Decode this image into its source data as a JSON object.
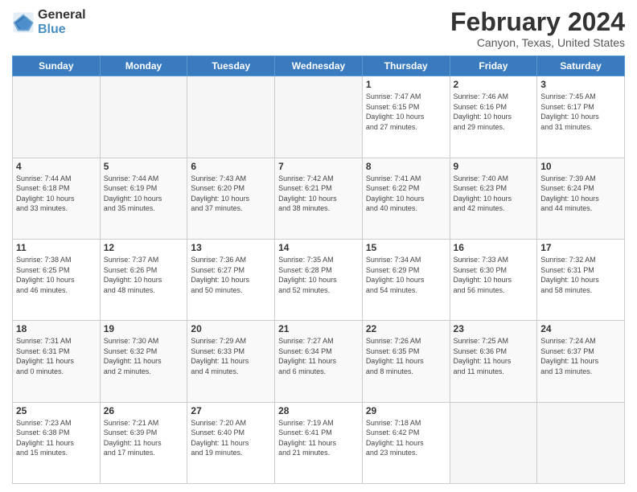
{
  "header": {
    "logo_line1": "General",
    "logo_line2": "Blue",
    "title": "February 2024",
    "subtitle": "Canyon, Texas, United States"
  },
  "days_of_week": [
    "Sunday",
    "Monday",
    "Tuesday",
    "Wednesday",
    "Thursday",
    "Friday",
    "Saturday"
  ],
  "weeks": [
    [
      {
        "day": "",
        "info": ""
      },
      {
        "day": "",
        "info": ""
      },
      {
        "day": "",
        "info": ""
      },
      {
        "day": "",
        "info": ""
      },
      {
        "day": "1",
        "info": "Sunrise: 7:47 AM\nSunset: 6:15 PM\nDaylight: 10 hours\nand 27 minutes."
      },
      {
        "day": "2",
        "info": "Sunrise: 7:46 AM\nSunset: 6:16 PM\nDaylight: 10 hours\nand 29 minutes."
      },
      {
        "day": "3",
        "info": "Sunrise: 7:45 AM\nSunset: 6:17 PM\nDaylight: 10 hours\nand 31 minutes."
      }
    ],
    [
      {
        "day": "4",
        "info": "Sunrise: 7:44 AM\nSunset: 6:18 PM\nDaylight: 10 hours\nand 33 minutes."
      },
      {
        "day": "5",
        "info": "Sunrise: 7:44 AM\nSunset: 6:19 PM\nDaylight: 10 hours\nand 35 minutes."
      },
      {
        "day": "6",
        "info": "Sunrise: 7:43 AM\nSunset: 6:20 PM\nDaylight: 10 hours\nand 37 minutes."
      },
      {
        "day": "7",
        "info": "Sunrise: 7:42 AM\nSunset: 6:21 PM\nDaylight: 10 hours\nand 38 minutes."
      },
      {
        "day": "8",
        "info": "Sunrise: 7:41 AM\nSunset: 6:22 PM\nDaylight: 10 hours\nand 40 minutes."
      },
      {
        "day": "9",
        "info": "Sunrise: 7:40 AM\nSunset: 6:23 PM\nDaylight: 10 hours\nand 42 minutes."
      },
      {
        "day": "10",
        "info": "Sunrise: 7:39 AM\nSunset: 6:24 PM\nDaylight: 10 hours\nand 44 minutes."
      }
    ],
    [
      {
        "day": "11",
        "info": "Sunrise: 7:38 AM\nSunset: 6:25 PM\nDaylight: 10 hours\nand 46 minutes."
      },
      {
        "day": "12",
        "info": "Sunrise: 7:37 AM\nSunset: 6:26 PM\nDaylight: 10 hours\nand 48 minutes."
      },
      {
        "day": "13",
        "info": "Sunrise: 7:36 AM\nSunset: 6:27 PM\nDaylight: 10 hours\nand 50 minutes."
      },
      {
        "day": "14",
        "info": "Sunrise: 7:35 AM\nSunset: 6:28 PM\nDaylight: 10 hours\nand 52 minutes."
      },
      {
        "day": "15",
        "info": "Sunrise: 7:34 AM\nSunset: 6:29 PM\nDaylight: 10 hours\nand 54 minutes."
      },
      {
        "day": "16",
        "info": "Sunrise: 7:33 AM\nSunset: 6:30 PM\nDaylight: 10 hours\nand 56 minutes."
      },
      {
        "day": "17",
        "info": "Sunrise: 7:32 AM\nSunset: 6:31 PM\nDaylight: 10 hours\nand 58 minutes."
      }
    ],
    [
      {
        "day": "18",
        "info": "Sunrise: 7:31 AM\nSunset: 6:31 PM\nDaylight: 11 hours\nand 0 minutes."
      },
      {
        "day": "19",
        "info": "Sunrise: 7:30 AM\nSunset: 6:32 PM\nDaylight: 11 hours\nand 2 minutes."
      },
      {
        "day": "20",
        "info": "Sunrise: 7:29 AM\nSunset: 6:33 PM\nDaylight: 11 hours\nand 4 minutes."
      },
      {
        "day": "21",
        "info": "Sunrise: 7:27 AM\nSunset: 6:34 PM\nDaylight: 11 hours\nand 6 minutes."
      },
      {
        "day": "22",
        "info": "Sunrise: 7:26 AM\nSunset: 6:35 PM\nDaylight: 11 hours\nand 8 minutes."
      },
      {
        "day": "23",
        "info": "Sunrise: 7:25 AM\nSunset: 6:36 PM\nDaylight: 11 hours\nand 11 minutes."
      },
      {
        "day": "24",
        "info": "Sunrise: 7:24 AM\nSunset: 6:37 PM\nDaylight: 11 hours\nand 13 minutes."
      }
    ],
    [
      {
        "day": "25",
        "info": "Sunrise: 7:23 AM\nSunset: 6:38 PM\nDaylight: 11 hours\nand 15 minutes."
      },
      {
        "day": "26",
        "info": "Sunrise: 7:21 AM\nSunset: 6:39 PM\nDaylight: 11 hours\nand 17 minutes."
      },
      {
        "day": "27",
        "info": "Sunrise: 7:20 AM\nSunset: 6:40 PM\nDaylight: 11 hours\nand 19 minutes."
      },
      {
        "day": "28",
        "info": "Sunrise: 7:19 AM\nSunset: 6:41 PM\nDaylight: 11 hours\nand 21 minutes."
      },
      {
        "day": "29",
        "info": "Sunrise: 7:18 AM\nSunset: 6:42 PM\nDaylight: 11 hours\nand 23 minutes."
      },
      {
        "day": "",
        "info": ""
      },
      {
        "day": "",
        "info": ""
      }
    ]
  ]
}
